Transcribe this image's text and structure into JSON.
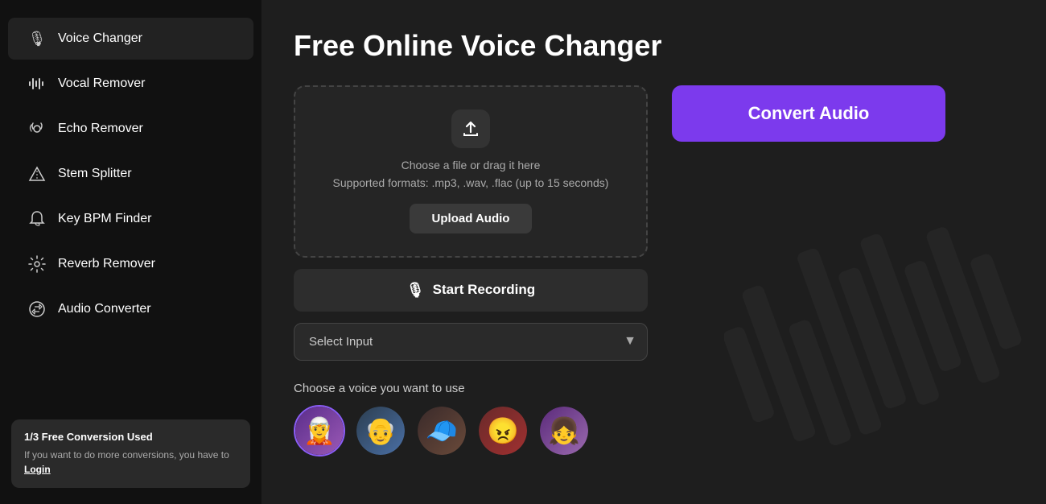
{
  "sidebar": {
    "items": [
      {
        "id": "voice-changer",
        "label": "Voice Changer",
        "icon": "🎙",
        "active": true
      },
      {
        "id": "vocal-remover",
        "label": "Vocal Remover",
        "icon": "🎚",
        "active": false
      },
      {
        "id": "echo-remover",
        "label": "Echo Remover",
        "icon": "🔊",
        "active": false
      },
      {
        "id": "stem-splitter",
        "label": "Stem Splitter",
        "icon": "△",
        "active": false
      },
      {
        "id": "key-bpm-finder",
        "label": "Key BPM Finder",
        "icon": "🔔",
        "active": false
      },
      {
        "id": "reverb-remover",
        "label": "Reverb Remover",
        "icon": "⚙",
        "active": false
      },
      {
        "id": "audio-converter",
        "label": "Audio Converter",
        "icon": "🔄",
        "active": false
      }
    ]
  },
  "footer": {
    "title": "1/3 Free Conversion Used",
    "description": "If you want to do more conversions, you have to ",
    "link_label": "Login"
  },
  "main": {
    "page_title": "Free Online Voice Changer",
    "upload": {
      "hint_line1": "Choose a file or drag it here",
      "hint_line2": "Supported formats: .mp3, .wav, .flac (up to 15 seconds)",
      "button_label": "Upload Audio"
    },
    "record": {
      "button_label": "Start Recording"
    },
    "select_input": {
      "placeholder": "Select Input"
    },
    "voice_section": {
      "title": "Choose a voice you want to use"
    },
    "convert": {
      "button_label": "Convert Audio"
    }
  },
  "voices": [
    {
      "id": "v1",
      "emoji": "🧝",
      "color": "#5a3a8a",
      "selected": true
    },
    {
      "id": "v2",
      "emoji": "👴",
      "color": "#3a4a6a",
      "selected": false
    },
    {
      "id": "v3",
      "emoji": "🧢",
      "color": "#4a3a3a",
      "selected": false
    },
    {
      "id": "v4",
      "emoji": "😠",
      "color": "#6a2a2a",
      "selected": false
    },
    {
      "id": "v5",
      "emoji": "👧",
      "color": "#6a4a7a",
      "selected": false
    }
  ]
}
